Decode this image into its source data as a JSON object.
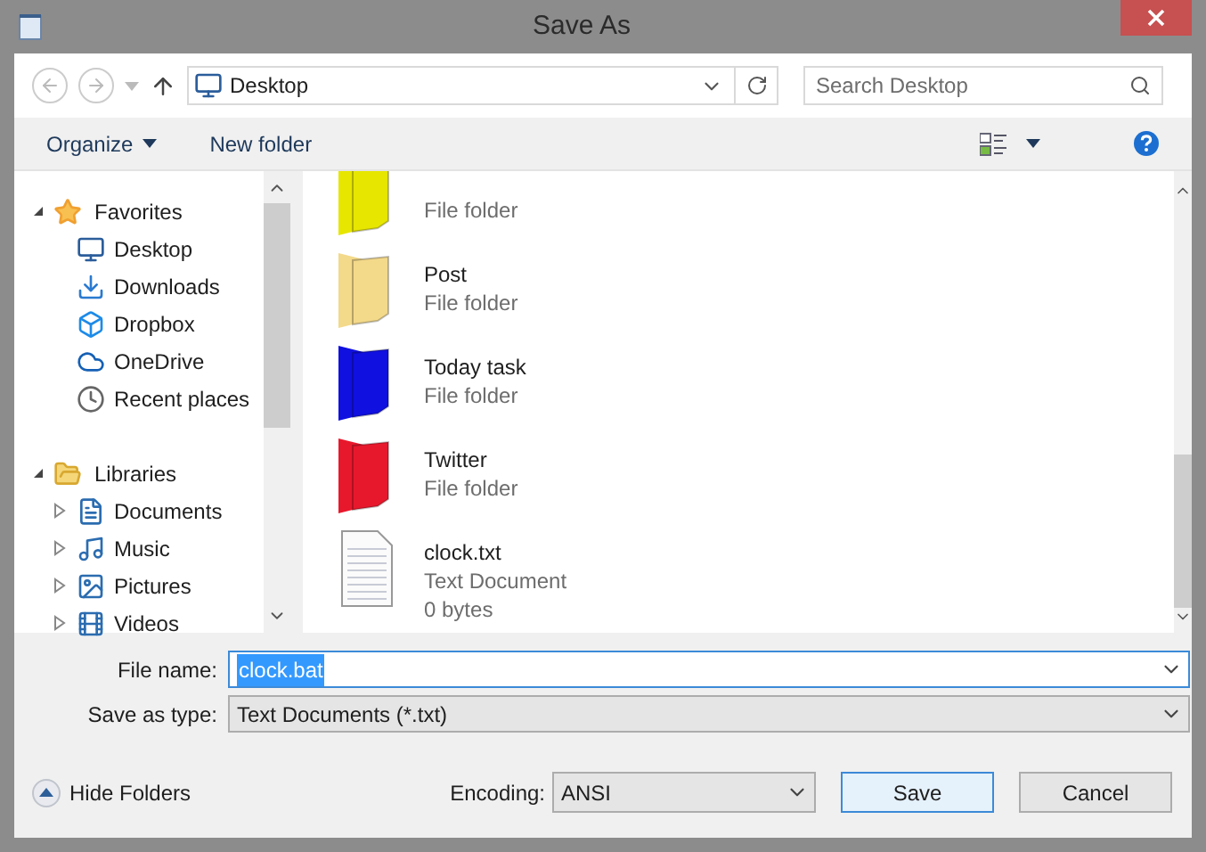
{
  "window": {
    "title": "Save As"
  },
  "address": {
    "location": "Desktop",
    "search_placeholder": "Search Desktop"
  },
  "toolbar": {
    "organize": "Organize",
    "new_folder": "New folder"
  },
  "sidebar": {
    "groups": [
      {
        "label": "Favorites",
        "expanded": true,
        "items": [
          {
            "label": "Desktop"
          },
          {
            "label": "Downloads"
          },
          {
            "label": "Dropbox"
          },
          {
            "label": "OneDrive"
          },
          {
            "label": "Recent places"
          }
        ]
      },
      {
        "label": "Libraries",
        "expanded": true,
        "items": [
          {
            "label": "Documents",
            "expanded": false
          },
          {
            "label": "Music",
            "expanded": false
          },
          {
            "label": "Pictures",
            "expanded": false
          },
          {
            "label": "Videos",
            "expanded": false
          }
        ]
      }
    ]
  },
  "files": [
    {
      "kind": "folder",
      "color": "#e6e600",
      "type": "File folder"
    },
    {
      "kind": "folder",
      "color": "#f3d98a",
      "name": "Post",
      "type": "File folder"
    },
    {
      "kind": "folder",
      "color": "#1010e0",
      "name": "Today task",
      "type": "File folder"
    },
    {
      "kind": "folder",
      "color": "#e8182c",
      "name": "Twitter",
      "type": "File folder"
    },
    {
      "kind": "text_file",
      "name": "clock.txt",
      "type": "Text Document",
      "size": "0 bytes"
    }
  ],
  "form": {
    "file_name_label": "File name:",
    "file_name": "clock.bat",
    "type_label": "Save as type:",
    "type": "Text Documents (*.txt)"
  },
  "footer": {
    "hide_folders": "Hide Folders",
    "encoding_label": "Encoding:",
    "encoding": "ANSI",
    "save": "Save",
    "cancel": "Cancel"
  }
}
